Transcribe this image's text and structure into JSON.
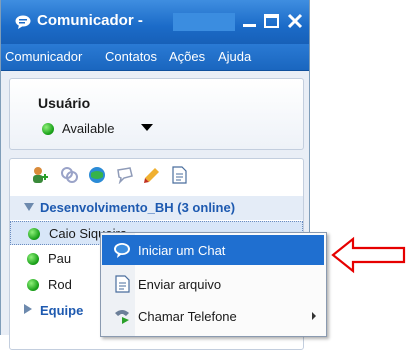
{
  "window": {
    "title": "Comunicador -"
  },
  "menu": [
    "Comunicador",
    "Contatos",
    "Ações",
    "Ajuda"
  ],
  "user": {
    "label": "Usuário",
    "status": "Available"
  },
  "toolbar_icons": [
    "add-contact-icon",
    "people-icon",
    "globe-icon",
    "bubble-icon",
    "paint-icon",
    "document-icon"
  ],
  "group": {
    "name": "Desenvolvimento_BH (3 online)"
  },
  "contacts": [
    {
      "name": "Caio Siqueira"
    },
    {
      "name": "Pau"
    },
    {
      "name": "Rod"
    }
  ],
  "group2": {
    "name": "Equipe"
  },
  "context_menu": [
    {
      "label": "Iniciar um Chat",
      "icon": "chat-icon"
    },
    {
      "label": "Enviar arquivo",
      "icon": "file-icon"
    },
    {
      "label": "Chamar Telefone",
      "icon": "phone-icon"
    }
  ],
  "colors": {
    "accent": "#1f6fd0",
    "titlebar": "#1b6bc8",
    "status": "#1aa21a",
    "annotation": "#e60000"
  }
}
